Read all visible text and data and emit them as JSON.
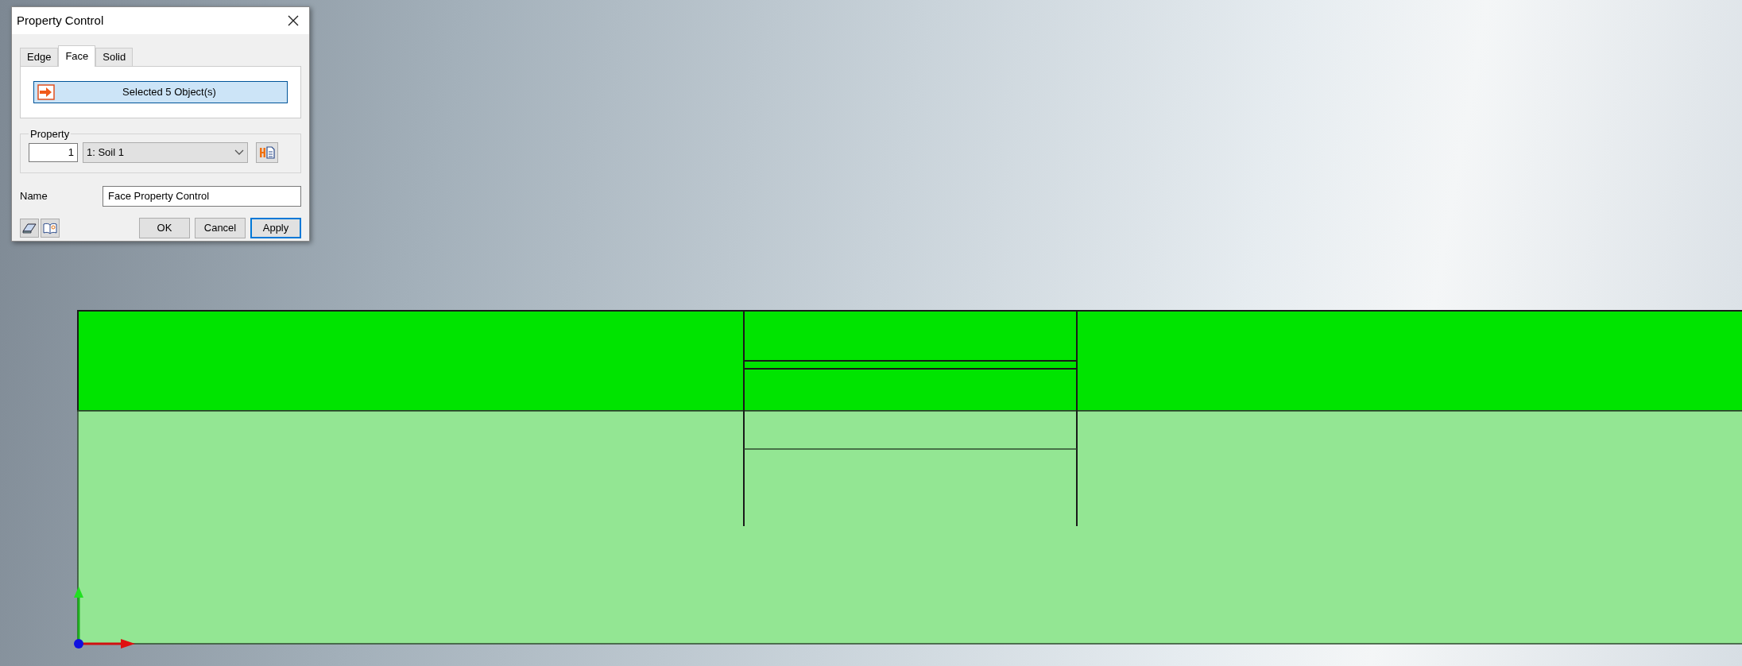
{
  "dialog": {
    "title": "Property Control",
    "tabs": [
      {
        "label": "Edge",
        "selected": false
      },
      {
        "label": "Face",
        "selected": true
      },
      {
        "label": "Solid",
        "selected": false
      }
    ],
    "selection_button": "Selected 5 Object(s)",
    "property": {
      "label": "Property",
      "number": "1",
      "select": "1: Soil 1"
    },
    "name": {
      "label": "Name",
      "value": "Face Property Control"
    },
    "buttons": [
      {
        "label": "OK",
        "default": false
      },
      {
        "label": "Cancel",
        "default": false
      },
      {
        "label": "Apply",
        "default": true
      }
    ]
  }
}
